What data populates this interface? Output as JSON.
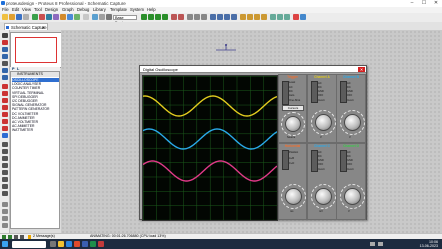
{
  "window": {
    "title": "proteusdesign - Proteus 8 Professional - Schematic Capture",
    "min": "–",
    "max": "☐",
    "close": "✕"
  },
  "menu": [
    "File",
    "Edit",
    "View",
    "Tool",
    "Design",
    "Graph",
    "Debug",
    "Library",
    "Template",
    "System",
    "Help"
  ],
  "toolbar": {
    "zoom_value": "Base Design"
  },
  "tab": {
    "label": "Schematic Capture"
  },
  "panel": {
    "p_label": "P",
    "l_label": "L",
    "header": "INSTRUMENTS"
  },
  "instruments": [
    "OSCILLOSCOPE",
    "LOGIC ANALYSER",
    "COUNTER TIMER",
    "VIRTUAL TERMINAL",
    "SPI DEBUGGER",
    "I2C DEBUGGER",
    "SIGNAL GENERATOR",
    "PATTERN GENERATOR",
    "DC VOLTMETER",
    "DC AMMETER",
    "AC VOLTMETER",
    "AC AMMETER",
    "WATTMETER"
  ],
  "instrument_selected": "OSCILLOSCOPE",
  "osc": {
    "title": "Digital Oscilloscope",
    "close": "✕",
    "trigger": "Trigger",
    "channel_a": "Channel A",
    "channel_b": "Channel B",
    "channel_c": "Channel C",
    "channel_d": "Channel D",
    "horizontal": "Horizontal",
    "source": "Source",
    "level": "Level",
    "auto": "Auto",
    "one_shot": "One-Shot",
    "cursors": "Cursors",
    "ac": "AC",
    "dc": "DC",
    "gnd": "GND",
    "off": "OFF",
    "invert": "Invert",
    "position": "Position",
    "a_plus_b": "A+B",
    "c_plus_d": "C+D",
    "ms_label": "ms",
    "v_label": "V",
    "mv_label": "mV"
  },
  "waves": {
    "yellow": "#e2cc1f",
    "blue": "#2aa9e8",
    "pink": "#e03a88"
  },
  "status": {
    "messages": "2 Message(s)",
    "sim_info": "ANIMATING: 00:01:26.706880 (CPU load 13%)"
  },
  "coord_label": "ΔX: 0.0",
  "clock": {
    "time": "10:06",
    "date": "13-06-2023"
  }
}
